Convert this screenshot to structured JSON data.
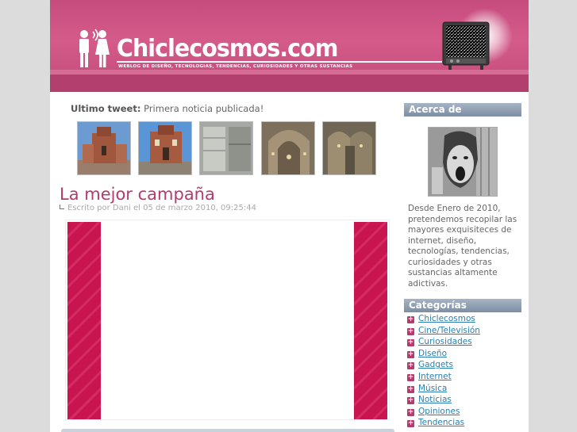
{
  "header": {
    "site_title": "Chiclecosmos.com",
    "tagline": "WEBLOG DE DISEÑO, TECNOLOGIAS, TENDENCIAS, CURIOSIDADES Y OTRAS SUSTANCIAS"
  },
  "tweet": {
    "label": "Ultimo tweet:",
    "text": "Primera noticia publicada!"
  },
  "gallery": {
    "thumb_count": 5
  },
  "post": {
    "title": "La mejor campaña",
    "meta": "Escrito por Dani el 05 de marzo 2010, 09:25:44"
  },
  "sidebar": {
    "about_heading": "Acerca de",
    "about_text": "Desde Enero de 2010, pretendemos recopilar las mayores exquisiteces de internet, diseño, tecnologías, tendencias, curiosidades y otras sustancias altamente adictivas.",
    "categories_heading": "Categorías",
    "categories": [
      "Chiclecosmos",
      "Cine/Televisión",
      "Curiosidades",
      "Diseño",
      "Gadgets",
      "Internet",
      "Música",
      "Noticias",
      "Opiniones",
      "Tendencias"
    ]
  },
  "colors": {
    "header_pink": "#c64c7e",
    "title_pink": "#b53a6e",
    "link_blue": "#2a7fae",
    "sidebar_heading": "#7d8ea3",
    "video_stripe": "#c8144f"
  }
}
